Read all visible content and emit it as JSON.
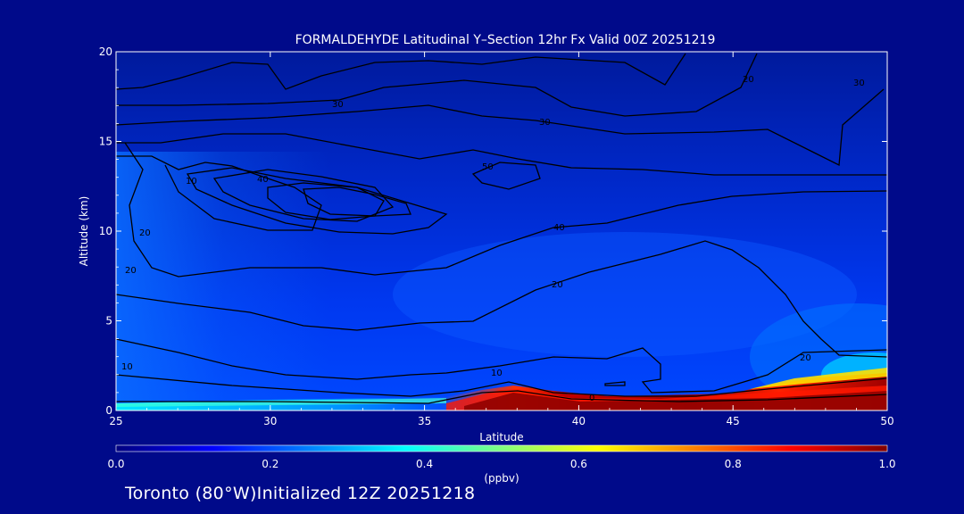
{
  "chart_data": {
    "type": "heatmap",
    "title": "FORMALDEHYDE Latitudinal Y–Section 12hr  Fx Valid 00Z 20251219",
    "xlabel": "Latitude",
    "ylabel": "Altitude (km)",
    "xlim": [
      25,
      50
    ],
    "ylim": [
      0,
      20
    ],
    "x_ticks": [
      "25",
      "30",
      "35",
      "40",
      "45",
      "50"
    ],
    "y_ticks": [
      "0",
      "5",
      "10",
      "15",
      "20"
    ],
    "colorbar": {
      "label": "(ppbv)",
      "min": 0.0,
      "max": 1.0,
      "ticks": [
        "0.0",
        "0.2",
        "0.4",
        "0.6",
        "0.8",
        "1.0"
      ],
      "colors": [
        "#00007f",
        "#0000ff",
        "#0080ff",
        "#00ffff",
        "#80ff80",
        "#ffff00",
        "#ff8000",
        "#ff0000",
        "#7f0000"
      ]
    },
    "surface_layer": {
      "description_values_ppbv": [
        {
          "lat": 25,
          "alt_km": 0.1,
          "value": 0.35
        },
        {
          "lat": 30,
          "alt_km": 0.1,
          "value": 0.25
        },
        {
          "lat": 35,
          "alt_km": 0.1,
          "value": 0.2
        },
        {
          "lat": 38,
          "alt_km": 0.5,
          "value": 1.0
        },
        {
          "lat": 42,
          "alt_km": 0.3,
          "value": 1.0
        },
        {
          "lat": 46,
          "alt_km": 0.5,
          "value": 0.9
        },
        {
          "lat": 50,
          "alt_km": 1.0,
          "value": 1.0
        }
      ]
    },
    "contour_labels": [
      "10",
      "20",
      "30",
      "40",
      "50",
      "20",
      "30",
      "40",
      "20",
      "10",
      "0",
      "20",
      "30",
      "10",
      "20"
    ]
  },
  "footer": {
    "station_text": "Toronto (80°W)Initialized 12Z 20251218"
  }
}
